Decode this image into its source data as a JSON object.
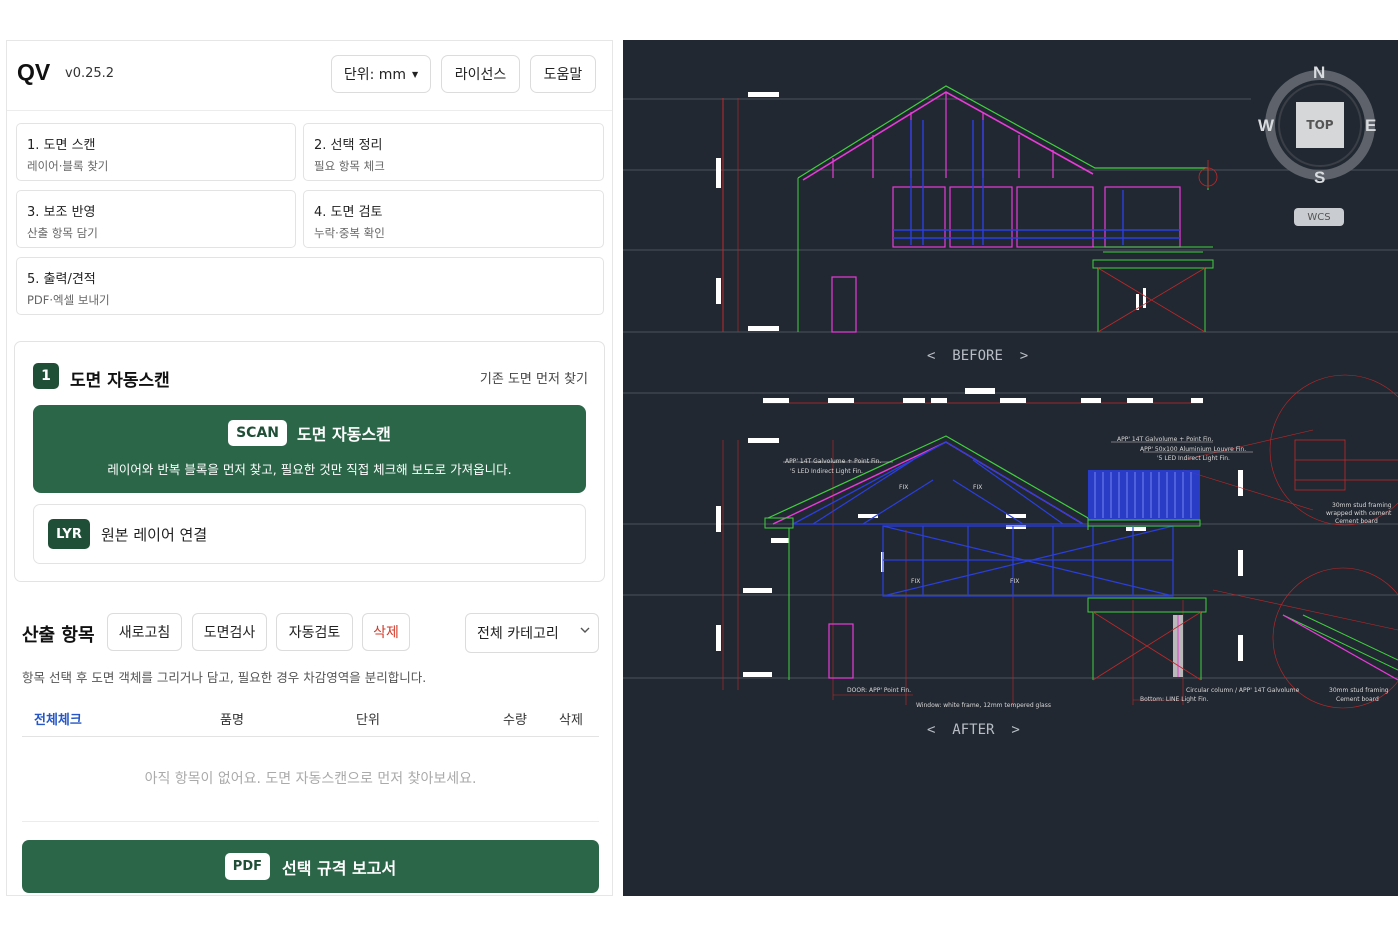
{
  "header": {
    "logo": "QV",
    "version": "v0.25.2",
    "unit_label": "단위: mm",
    "license_label": "라이선스",
    "help_label": "도움말"
  },
  "steps": [
    {
      "title": "1. 도면 스캔",
      "sub": "레이어·블록 찾기"
    },
    {
      "title": "2. 선택 정리",
      "sub": "필요 항목 체크"
    },
    {
      "title": "3. 보조 반영",
      "sub": "산출 항목 담기"
    },
    {
      "title": "4. 도면 검토",
      "sub": "누락·중복 확인"
    },
    {
      "title": "5. 출력/견적",
      "sub": "PDF·엑셀 보내기"
    }
  ],
  "scan_card": {
    "number": "1",
    "title": "도면 자동스캔",
    "link": "기존 도면 먼저 찾기",
    "scan_tag": "SCAN",
    "scan_label": "도면 자동스캔",
    "scan_desc": "레이어와 반복 블록을 먼저 찾고, 필요한 것만 직접 체크해 보도로 가져옵니다.",
    "lyr_tag": "LYR",
    "lyr_label": "원본 레이어 연결"
  },
  "items": {
    "title": "산출 항목",
    "refresh": "새로고침",
    "drawing_check": "도면검사",
    "auto_check": "자동검토",
    "delete": "삭제",
    "category": "전체 카테고리",
    "hint": "항목 선택 후 도면 객체를 그리거나 담고, 필요한 경우 차감영역을 분리합니다.",
    "columns": [
      "전체체크",
      "품명",
      "단위",
      "수량",
      "삭제"
    ],
    "empty": "아직 항목이 없어요. 도면 자동스캔으로 먼저 찾아보세요.",
    "pdf_tag": "PDF",
    "pdf_label": "선택 규격 보고서"
  },
  "viewport": {
    "compass": {
      "n": "N",
      "s": "S",
      "e": "E",
      "w": "W"
    },
    "cube": "TOP",
    "wcs": "WCS",
    "before_label": "BEFORE",
    "after_label": "AFTER",
    "notes": [
      "APP' 14T Galvolume + Point Fin.",
      "'5 LED Indirect Light Fin.",
      "APP' 14T Galvolume + Point Fin.",
      "APP' 50x100 Aluminium Louvre Fin.",
      "'5 LED Indirect Light Fin.",
      "FIX",
      "FIX",
      "FIX",
      "FIX",
      "30mm stud framing",
      "wrapped with cement",
      "Cement board",
      "DOOR: APP' Point Fin.",
      "Window: white frame, 12mm tempered glass",
      "Circular column / APP' 14T Galvolume",
      "Bottom: LINE Light Fin.",
      "30mm stud framing",
      "Cement board"
    ]
  },
  "colors": {
    "accent_green": "#2b6648",
    "dark_green": "#1f4f36",
    "delete_red": "#d23a2a",
    "link_blue": "#2456c8",
    "viewport_bg": "#222831"
  }
}
